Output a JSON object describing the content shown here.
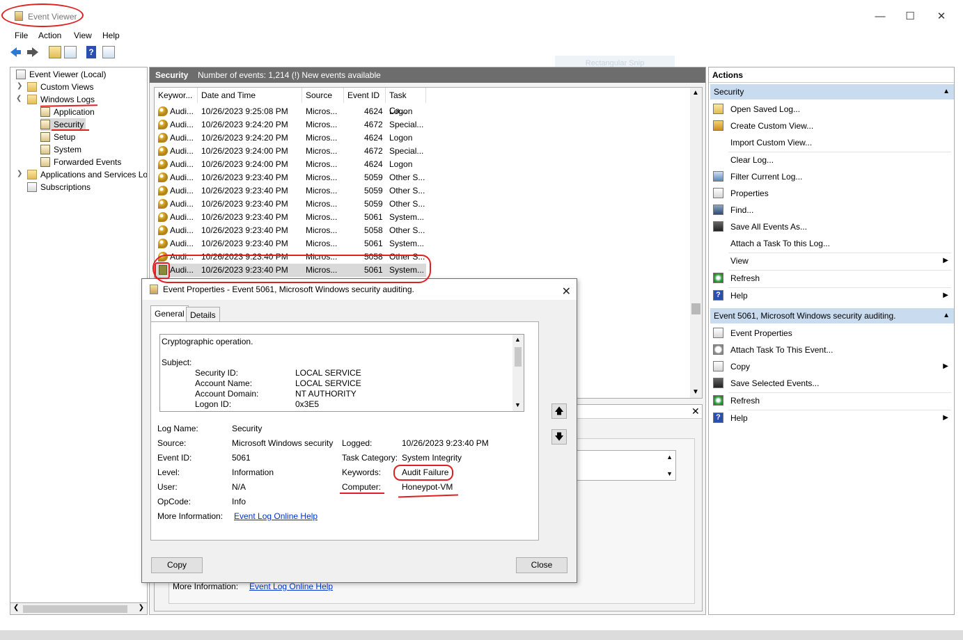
{
  "window": {
    "title": "Event Viewer"
  },
  "menu": [
    "File",
    "Action",
    "View",
    "Help"
  ],
  "watermark": "Rectangular Snip",
  "tree": {
    "root": "Event Viewer (Local)",
    "custom_views": "Custom Views",
    "windows_logs": "Windows Logs",
    "application": "Application",
    "security": "Security",
    "setup": "Setup",
    "system": "System",
    "forwarded": "Forwarded Events",
    "apps_services": "Applications and Services Lo",
    "subscriptions": "Subscriptions"
  },
  "log_header": {
    "name": "Security",
    "info": "Number of events: 1,214 (!) New events available"
  },
  "columns": [
    "Keywor...",
    "Date and Time",
    "Source",
    "Event ID",
    "Task Ca..."
  ],
  "events": [
    {
      "kw": "Audi...",
      "dt": "10/26/2023 9:25:08 PM",
      "src": "Micros...",
      "id": "4624",
      "task": "Logon"
    },
    {
      "kw": "Audi...",
      "dt": "10/26/2023 9:24:20 PM",
      "src": "Micros...",
      "id": "4672",
      "task": "Special..."
    },
    {
      "kw": "Audi...",
      "dt": "10/26/2023 9:24:20 PM",
      "src": "Micros...",
      "id": "4624",
      "task": "Logon"
    },
    {
      "kw": "Audi...",
      "dt": "10/26/2023 9:24:00 PM",
      "src": "Micros...",
      "id": "4672",
      "task": "Special..."
    },
    {
      "kw": "Audi...",
      "dt": "10/26/2023 9:24:00 PM",
      "src": "Micros...",
      "id": "4624",
      "task": "Logon"
    },
    {
      "kw": "Audi...",
      "dt": "10/26/2023 9:23:40 PM",
      "src": "Micros...",
      "id": "5059",
      "task": "Other S..."
    },
    {
      "kw": "Audi...",
      "dt": "10/26/2023 9:23:40 PM",
      "src": "Micros...",
      "id": "5059",
      "task": "Other S..."
    },
    {
      "kw": "Audi...",
      "dt": "10/26/2023 9:23:40 PM",
      "src": "Micros...",
      "id": "5059",
      "task": "Other S..."
    },
    {
      "kw": "Audi...",
      "dt": "10/26/2023 9:23:40 PM",
      "src": "Micros...",
      "id": "5061",
      "task": "System..."
    },
    {
      "kw": "Audi...",
      "dt": "10/26/2023 9:23:40 PM",
      "src": "Micros...",
      "id": "5058",
      "task": "Other S..."
    },
    {
      "kw": "Audi...",
      "dt": "10/26/2023 9:23:40 PM",
      "src": "Micros...",
      "id": "5061",
      "task": "System..."
    },
    {
      "kw": "Audi...",
      "dt": "10/26/2023 9:23:40 PM",
      "src": "Micros...",
      "id": "5058",
      "task": "Other S..."
    },
    {
      "kw": "Audi...",
      "dt": "10/26/2023 9:23:40 PM",
      "src": "Micros...",
      "id": "5061",
      "task": "System..."
    }
  ],
  "lower_pane": {
    "more_info_label": "More Information:",
    "more_info_link": "Event Log Online Help"
  },
  "actions": {
    "header": "Actions",
    "section1": "Security",
    "items1": [
      "Open Saved Log...",
      "Create Custom View...",
      "Import Custom View...",
      "Clear Log...",
      "Filter Current Log...",
      "Properties",
      "Find...",
      "Save All Events As...",
      "Attach a Task To this Log...",
      "View",
      "Refresh",
      "Help"
    ],
    "section2": "Event 5061, Microsoft Windows security auditing.",
    "items2": [
      "Event Properties",
      "Attach Task To This Event...",
      "Copy",
      "Save Selected Events...",
      "Refresh",
      "Help"
    ]
  },
  "dialog": {
    "title": "Event Properties - Event 5061, Microsoft Windows security auditing.",
    "tabs": [
      "General",
      "Details"
    ],
    "description": {
      "line1": "Cryptographic operation.",
      "subject": "Subject:",
      "fields": [
        {
          "k": "Security ID:",
          "v": "LOCAL SERVICE"
        },
        {
          "k": "Account Name:",
          "v": "LOCAL SERVICE"
        },
        {
          "k": "Account Domain:",
          "v": "NT AUTHORITY"
        },
        {
          "k": "Logon ID:",
          "v": "0x3E5"
        }
      ]
    },
    "log_name_label": "Log Name:",
    "log_name": "Security",
    "source_label": "Source:",
    "source": "Microsoft Windows security",
    "logged_label": "Logged:",
    "logged": "10/26/2023 9:23:40 PM",
    "event_id_label": "Event ID:",
    "event_id": "5061",
    "task_category_label": "Task Category:",
    "task_category": "System Integrity",
    "level_label": "Level:",
    "level": "Information",
    "keywords_label": "Keywords:",
    "keywords": "Audit Failure",
    "user_label": "User:",
    "user": "N/A",
    "computer_label": "Computer:",
    "computer": "Honeypot-VM",
    "opcode_label": "OpCode:",
    "opcode": "Info",
    "more_info_label": "More Information:",
    "more_info_link": "Event Log Online Help",
    "copy_button": "Copy",
    "close_button": "Close"
  },
  "colors": {
    "annotation": "#e02020",
    "header_gray": "#6d6d6d",
    "section_blue": "#c9dbee",
    "link": "#0033cc"
  }
}
